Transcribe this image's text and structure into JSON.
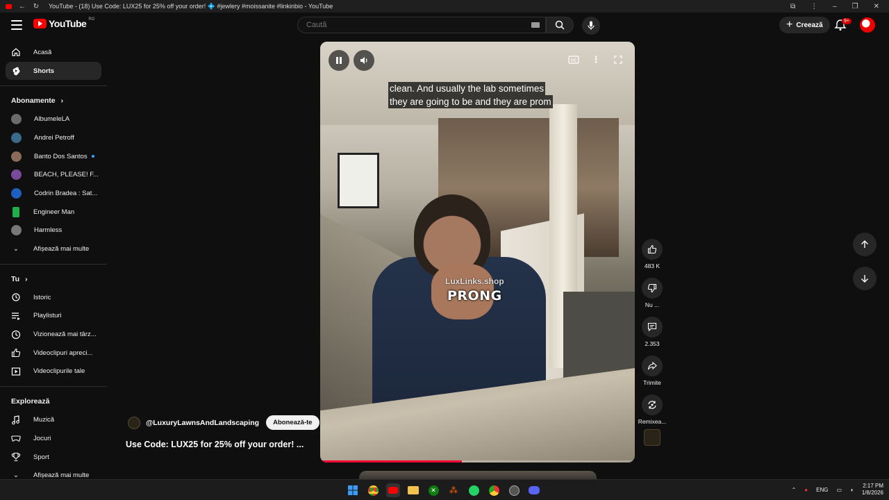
{
  "window": {
    "title": "YouTube - (18) Use Code: LUX25 for 25% off your order! 💠 #jewlery #moissanite #linkinbio - YouTube"
  },
  "header": {
    "logo_text": "YouTube",
    "logo_region": "RO",
    "search_placeholder": "Caută",
    "create_label": "Creează",
    "notifications_badge": "9+"
  },
  "sidebar": {
    "main": [
      {
        "label": "Acasă",
        "icon": "home-icon"
      },
      {
        "label": "Shorts",
        "icon": "shorts-icon",
        "active": true
      }
    ],
    "subscriptions_heading": "Abonamente",
    "subscriptions": [
      {
        "label": "AlbumeleLA",
        "color": "#6b6b6b"
      },
      {
        "label": "Andrei Petroff",
        "color": "#3a6b8a"
      },
      {
        "label": "Banto Dos Santos",
        "color": "#8a6b5a",
        "new": true
      },
      {
        "label": "BEACH, PLEASE! F...",
        "color": "#7a4a9a"
      },
      {
        "label": "Codrin Bradea : Sat...",
        "color": "#1e5fbf"
      },
      {
        "label": "Engineer Man",
        "color": "#1fae4a"
      },
      {
        "label": "Harmless",
        "color": "#777777"
      }
    ],
    "subscriptions_more": "Afișează mai multe",
    "you_heading": "Tu",
    "you": [
      {
        "label": "Istoric",
        "icon": "history-icon"
      },
      {
        "label": "Playlisturi",
        "icon": "playlist-icon"
      },
      {
        "label": "Vizionează mai târz...",
        "icon": "watch-later-icon"
      },
      {
        "label": "Videoclipuri apreci...",
        "icon": "like-icon"
      },
      {
        "label": "Videoclipurile tale",
        "icon": "your-videos-icon"
      }
    ],
    "explore_heading": "Explorează",
    "explore": [
      {
        "label": "Muzică",
        "icon": "music-icon"
      },
      {
        "label": "Jocuri",
        "icon": "gaming-icon"
      },
      {
        "label": "Sport",
        "icon": "trophy-icon"
      }
    ],
    "explore_more": "Afișează mai multe"
  },
  "short": {
    "caption_line1": "clean. And usually the lab sometimes",
    "caption_line2": "they are going to be and they are prom",
    "overlay_brand": "LuxLinks.shop",
    "overlay_word": "PRONG",
    "progress_fraction": 0.45,
    "channel": "@LuxuryLawnsAndLandscaping",
    "subscribe_label": "Abonează-te",
    "title": "Use Code: LUX25 for 25% off your order! ..."
  },
  "actions": {
    "likes": "483 K",
    "dislike_label": "Nu ...",
    "comments": "2.353",
    "share_label": "Trimite",
    "remix_label": "Remixea..."
  },
  "taskbar": {
    "lang": "ENG",
    "time": "2:17 PM",
    "date": "1/8/2026"
  }
}
